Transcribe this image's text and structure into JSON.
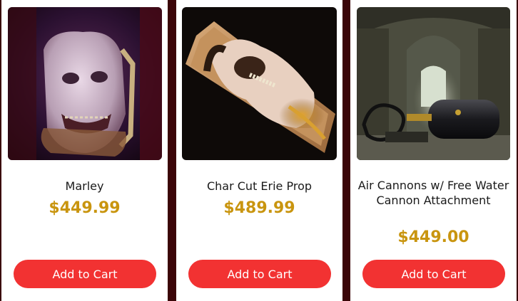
{
  "theme": {
    "background": "#3b0508",
    "price_color": "#c9950f",
    "button_color": "#f23232"
  },
  "products": [
    {
      "name": "Marley",
      "price": "$449.99",
      "button_label": "Add to Cart",
      "image_alt": "Marley prop photo"
    },
    {
      "name": "Char Cut Erie Prop",
      "price": "$489.99",
      "button_label": "Add to Cart",
      "image_alt": "Char Cut Erie Prop photo"
    },
    {
      "name": "Air Cannons w/ Free Water Cannon Attachment",
      "price": "$449.00",
      "button_label": "Add to Cart",
      "image_alt": "Air cannon photo"
    }
  ]
}
